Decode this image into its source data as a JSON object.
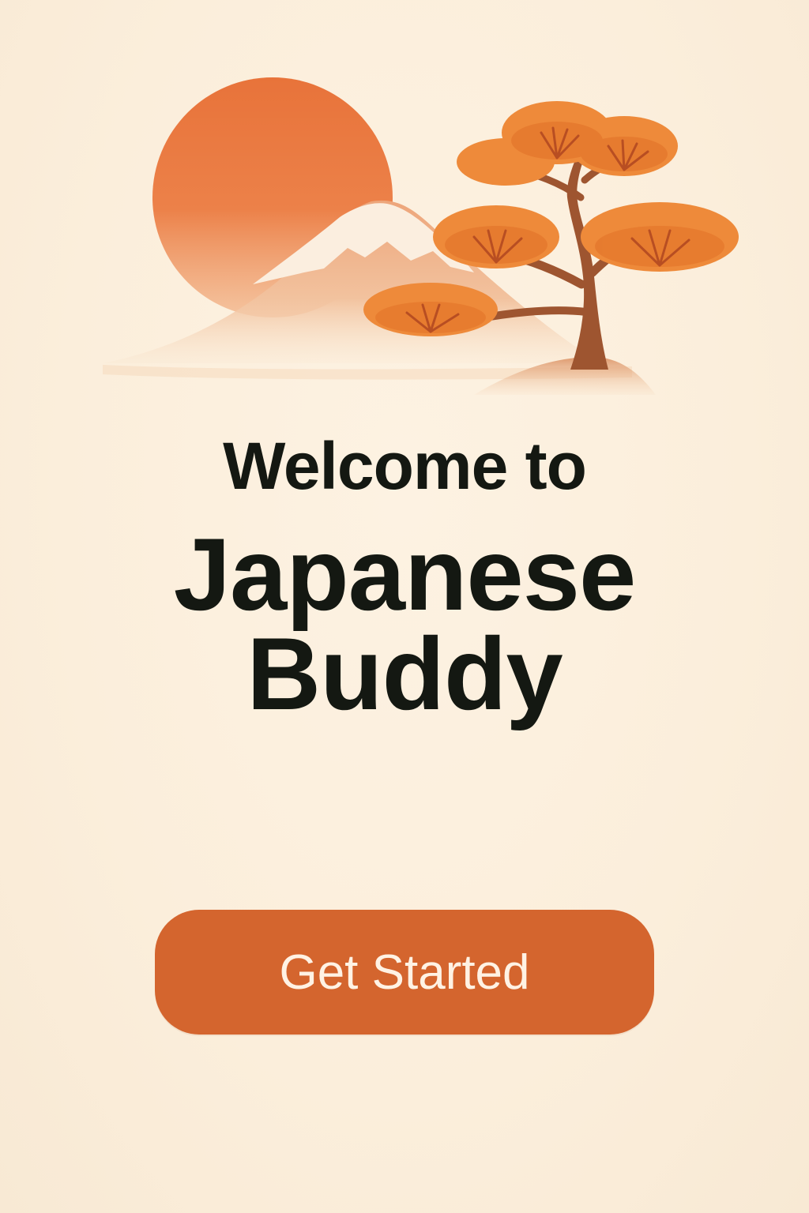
{
  "welcome": {
    "line1": "Welcome to",
    "title_line1": "Japanese",
    "title_line2": "Buddy"
  },
  "cta": {
    "label": "Get Started"
  },
  "colors": {
    "background": "#FBEEDB",
    "accent": "#D4652E",
    "sun": "#E8733A",
    "text": "#141812"
  },
  "illustration": {
    "icons": [
      "sun-icon",
      "mountain-icon",
      "pine-tree-icon"
    ]
  }
}
